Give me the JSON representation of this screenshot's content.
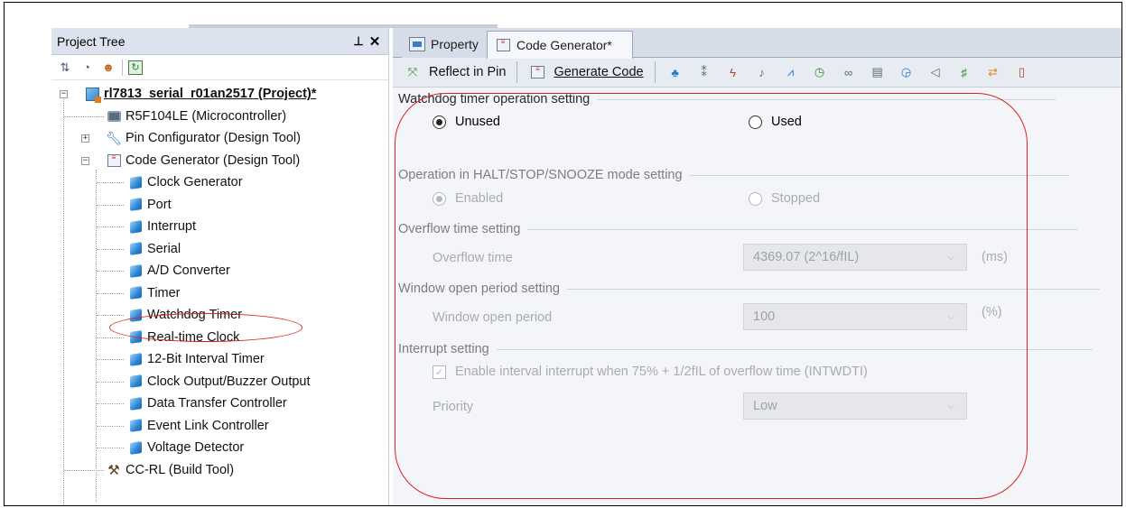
{
  "project_tree": {
    "title": "Project Tree",
    "pin_glyph": "⊥",
    "close_glyph": "✕",
    "nodes": {
      "project": "rl7813_serial_r01an2517 (Project)*",
      "microcontroller": "R5F104LE (Microcontroller)",
      "pin_configurator": "Pin Configurator (Design Tool)",
      "code_generator": "Code Generator (Design Tool)",
      "clock_generator": "Clock Generator",
      "port": "Port",
      "interrupt": "Interrupt",
      "serial": "Serial",
      "ad_converter": "A/D Converter",
      "timer": "Timer",
      "watchdog_timer": "Watchdog Timer",
      "rtc": "Real-time Clock",
      "interval_timer": "12-Bit Interval Timer",
      "clock_output": "Clock Output/Buzzer Output",
      "dtc": "Data Transfer Controller",
      "elc": "Event Link Controller",
      "voltage_detector": "Voltage Detector",
      "ccrl": "CC-RL (Build Tool)"
    }
  },
  "tabs": {
    "property": "Property",
    "code_generator": "Code Generator*"
  },
  "toolbar": {
    "reflect_in_pin": "Reflect in Pin",
    "generate_code": "Generate Code"
  },
  "settings": {
    "watchdog": {
      "title": "Watchdog timer operation setting",
      "unused": "Unused",
      "used": "Used",
      "selected": "Unused"
    },
    "halt_mode": {
      "title": "Operation in HALT/STOP/SNOOZE mode setting",
      "enabled": "Enabled",
      "stopped": "Stopped",
      "selected": "Enabled"
    },
    "overflow": {
      "title": "Overflow time setting",
      "label": "Overflow time",
      "value": "4369.07 (2^16/fIL)",
      "unit": "(ms)"
    },
    "window": {
      "title": "Window open period setting",
      "label": "Window open period",
      "value": "100",
      "unit": "(%)"
    },
    "interrupt": {
      "title": "Interrupt setting",
      "checkbox_label": "Enable interval interrupt when 75% + 1/2fIL of overflow time (INTWDTI)",
      "checked": true,
      "priority_label": "Priority",
      "priority_value": "Low"
    }
  },
  "colors": {
    "annotation": "#dd2222",
    "tab_strip": "#d7dde8"
  }
}
